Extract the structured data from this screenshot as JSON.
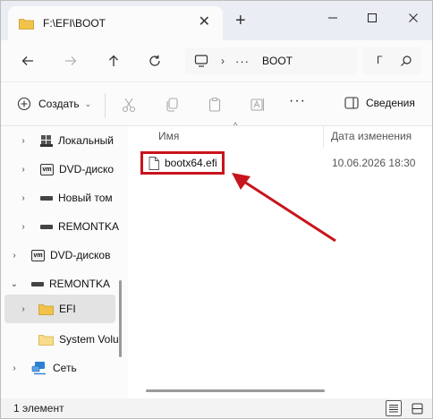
{
  "window": {
    "tab_title": "F:\\EFI\\BOOT",
    "new_tab_symbol": "+",
    "close_symbol": "✕"
  },
  "nav": {
    "address_more": "···",
    "address_current": "BOOT",
    "search_hint": "Г"
  },
  "toolbar": {
    "create_label": "Создать",
    "more": "···",
    "details_label": "Сведения"
  },
  "sidebar": {
    "items": [
      {
        "label": "Локальный",
        "icon": "local-drive-icon"
      },
      {
        "label": "DVD-диско",
        "icon": "vm-dvd-icon"
      },
      {
        "label": "Новый том",
        "icon": "drive-icon"
      },
      {
        "label": "REMONTKA",
        "icon": "drive-icon"
      },
      {
        "label": "DVD-дисков",
        "icon": "vm-dvd-icon"
      },
      {
        "label": "REMONTKA",
        "icon": "drive-icon"
      },
      {
        "label": "EFI",
        "icon": "folder-icon"
      },
      {
        "label": "System Volu",
        "icon": "folder-icon"
      },
      {
        "label": "Сеть",
        "icon": "network-icon"
      }
    ]
  },
  "main": {
    "col_name": "Имя",
    "col_date": "Дата изменения",
    "files": [
      {
        "name": "bootx64.efi",
        "date": "10.06.2026 18:30"
      }
    ]
  },
  "status": {
    "count": "1 элемент"
  },
  "colors": {
    "highlight_red": "#c8141c",
    "folder_yellow": "#f2c34b"
  }
}
